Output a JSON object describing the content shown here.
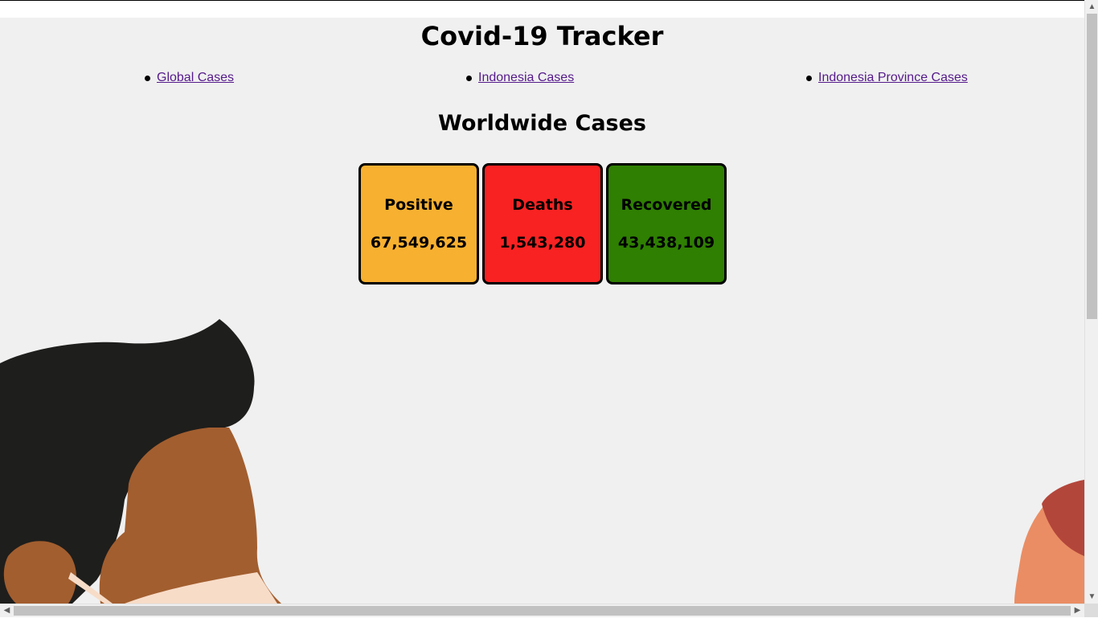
{
  "header": {
    "title": "Covid-19 Tracker"
  },
  "nav": {
    "items": [
      {
        "label": "Global Cases"
      },
      {
        "label": "Indonesia Cases"
      },
      {
        "label": "Indonesia Province Cases"
      }
    ]
  },
  "main": {
    "heading": "Worldwide Cases",
    "cards": [
      {
        "label": "Positive",
        "value": "67,549,625",
        "color": "#f7b030"
      },
      {
        "label": "Deaths",
        "value": "1,543,280",
        "color": "#f82222"
      },
      {
        "label": "Recovered",
        "value": "43,438,109",
        "color": "#2f7f02"
      }
    ]
  },
  "illustration": {
    "hair_color": "#1e1e1c",
    "skin_color": "#a25e2f",
    "right_skin_color": "#ea8d64",
    "right_hair_color": "#b3463b",
    "mask_color": "#f7dcc8"
  },
  "icons": {
    "bullet": "bullet-icon",
    "scroll_up": "scroll-up-icon",
    "scroll_down": "scroll-down-icon",
    "scroll_left": "scroll-left-icon",
    "scroll_right": "scroll-right-icon"
  }
}
